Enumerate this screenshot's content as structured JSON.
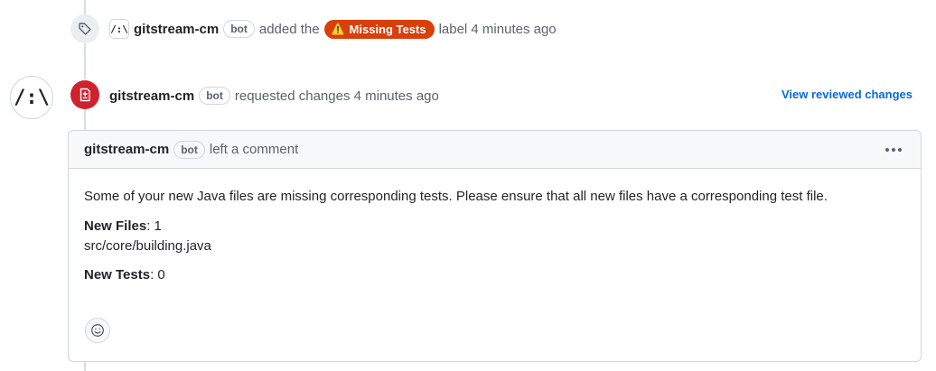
{
  "label_event": {
    "avatar_text": "/:\\",
    "author": "gitstream-cm",
    "bot_badge": "bot",
    "action": "added the",
    "label_name": "Missing Tests",
    "label_color": "#d93f0b",
    "suffix": "label 4 minutes ago",
    "icon": "tag-icon"
  },
  "review_event": {
    "avatar_text": "/:\\",
    "author": "gitstream-cm",
    "bot_badge": "bot",
    "action": "requested changes 4 minutes ago",
    "view_link": "View reviewed changes",
    "badge_color": "#cf222e",
    "icon": "file-diff-icon"
  },
  "comment": {
    "author": "gitstream-cm",
    "bot_badge": "bot",
    "action": "left a comment",
    "menu_icon": "kebab-horizontal-icon",
    "body_intro": "Some of your new Java files are missing corresponding tests. Please ensure that all new files have a corresponding test file.",
    "new_files_label": "New Files",
    "new_files_value": ": 1",
    "new_file_path": "src/core/building.java",
    "new_tests_label": "New Tests",
    "new_tests_value": ": 0",
    "reaction_icon": "smiley-icon"
  },
  "colors": {
    "link": "#0969da",
    "muted_text": "#59636e",
    "border": "#d0d7de"
  }
}
